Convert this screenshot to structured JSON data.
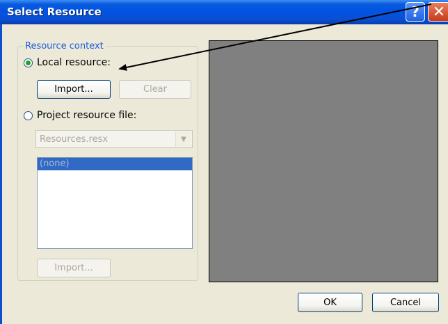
{
  "window": {
    "title": "Select Resource",
    "help_label": "?",
    "close_label": "✕"
  },
  "resource_context": {
    "legend": "Resource context",
    "local_resource": {
      "label": "Local resource:",
      "selected": true,
      "import_label": "Import...",
      "clear_label": "Clear"
    },
    "project_resource": {
      "label": "Project resource file:",
      "selected": false,
      "file_value": "Resources.resx",
      "list_items": [
        "(none)"
      ],
      "import_label": "Import..."
    }
  },
  "footer": {
    "ok_label": "OK",
    "cancel_label": "Cancel"
  },
  "colors": {
    "title_bar": "#0054e3",
    "preview_bg": "#808080",
    "radio_selected": "#21a121"
  },
  "icons": [
    "help-icon",
    "close-icon",
    "radio-checked-icon",
    "radio-unchecked-icon",
    "chevron-down-icon",
    "annotation-arrow"
  ]
}
